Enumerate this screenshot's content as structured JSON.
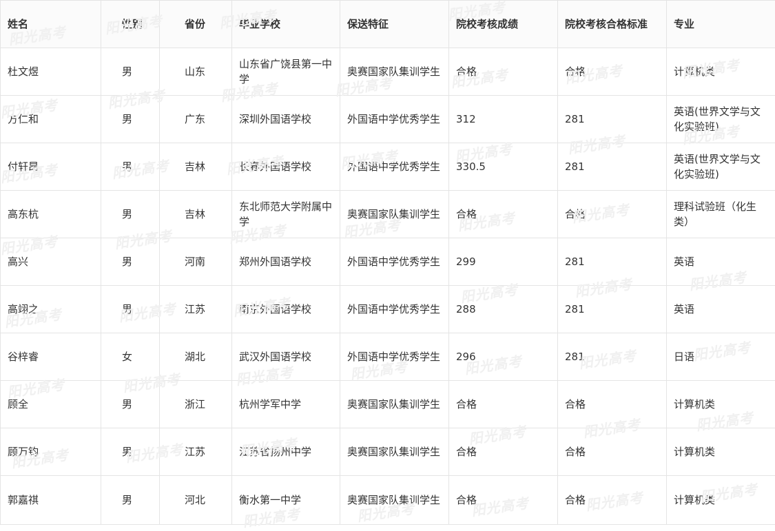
{
  "headers": {
    "name": "姓名",
    "gender": "性别",
    "province": "省份",
    "school": "毕业学校",
    "feature": "保送特征",
    "score": "院校考核成绩",
    "standard": "院校考核合格标准",
    "major": "专业"
  },
  "rows": [
    {
      "name": "杜文煜",
      "gender": "男",
      "province": "山东",
      "school": "山东省广饶县第一中学",
      "feature": "奥赛国家队集训学生",
      "score": "合格",
      "standard": "合格",
      "major": "计算机类"
    },
    {
      "name": "方仁和",
      "gender": "男",
      "province": "广东",
      "school": "深圳外国语学校",
      "feature": "外国语中学优秀学生",
      "score": "312",
      "standard": "281",
      "major": "英语(世界文学与文化实验班)"
    },
    {
      "name": "付轩昂",
      "gender": "男",
      "province": "吉林",
      "school": "长春外国语学校",
      "feature": "外国语中学优秀学生",
      "score": "330.5",
      "standard": "281",
      "major": "英语(世界文学与文化实验班)"
    },
    {
      "name": "高东杭",
      "gender": "男",
      "province": "吉林",
      "school": "东北师范大学附属中学",
      "feature": "奥赛国家队集训学生",
      "score": "合格",
      "standard": "合格",
      "major": "理科试验班（化生类）"
    },
    {
      "name": "高兴",
      "gender": "男",
      "province": "河南",
      "school": "郑州外国语学校",
      "feature": "外国语中学优秀学生",
      "score": "299",
      "standard": "281",
      "major": "英语"
    },
    {
      "name": "高翊之",
      "gender": "男",
      "province": "江苏",
      "school": "南京外国语学校",
      "feature": "外国语中学优秀学生",
      "score": "288",
      "standard": "281",
      "major": "英语"
    },
    {
      "name": "谷梓睿",
      "gender": "女",
      "province": "湖北",
      "school": "武汉外国语学校",
      "feature": "外国语中学优秀学生",
      "score": "296",
      "standard": "281",
      "major": "日语"
    },
    {
      "name": "顾全",
      "gender": "男",
      "province": "浙江",
      "school": "杭州学军中学",
      "feature": "奥赛国家队集训学生",
      "score": "合格",
      "standard": "合格",
      "major": "计算机类"
    },
    {
      "name": "顾万钧",
      "gender": "男",
      "province": "江苏",
      "school": "江苏省扬州中学",
      "feature": "奥赛国家队集训学生",
      "score": "合格",
      "standard": "合格",
      "major": "计算机类"
    },
    {
      "name": "郭嘉祺",
      "gender": "男",
      "province": "河北",
      "school": "衡水第一中学",
      "feature": "奥赛国家队集训学生",
      "score": "合格",
      "standard": "合格",
      "major": "计算机类"
    }
  ],
  "watermark": {
    "text": "阳光高考"
  }
}
